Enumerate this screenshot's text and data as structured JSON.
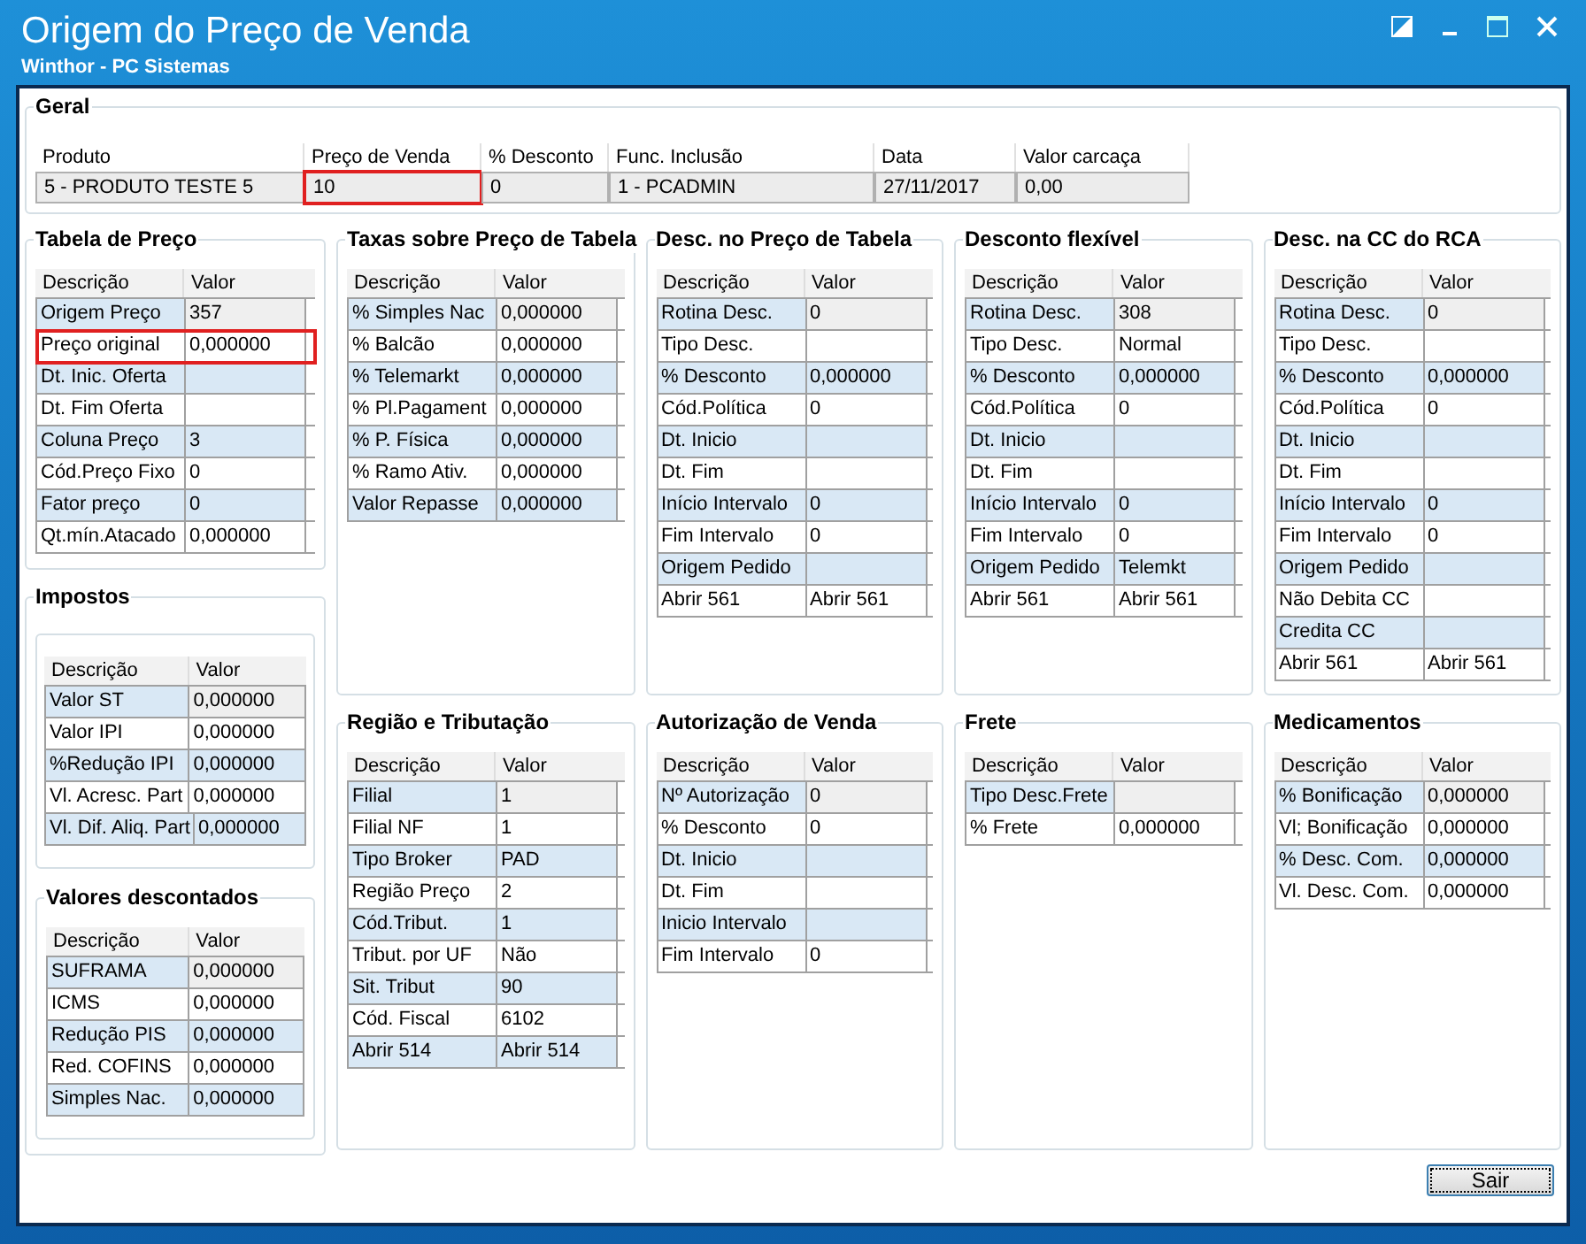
{
  "window": {
    "title": "Origem do Preço de Venda",
    "subtitle": "Winthor - PC Sistemas"
  },
  "geral": {
    "title": "Geral",
    "columns": [
      "Produto",
      "Preço de Venda",
      "% Desconto",
      "Func. Inclusão",
      "Data",
      "Valor carcaça"
    ],
    "row": [
      {
        "value": "5 - PRODUTO TESTE 5",
        "marked": false
      },
      {
        "value": "10",
        "marked": true
      },
      {
        "value": "0",
        "marked": false
      },
      {
        "value": "1 - PCADMIN",
        "marked": false
      },
      {
        "value": "27/11/2017",
        "marked": false
      },
      {
        "value": "0,00",
        "marked": false
      }
    ]
  },
  "columns": [
    [
      {
        "title": "Tabela de Preço",
        "kind": "plain",
        "headers": [
          "Descrição",
          "Valor"
        ],
        "rows": [
          {
            "label": "Origem Preço",
            "value": "357",
            "marked": false
          },
          {
            "label": "Preço original",
            "value": "0,000000",
            "marked": true
          },
          {
            "label": "Dt. Inic. Oferta",
            "value": "",
            "marked": false
          },
          {
            "label": "Dt. Fim Oferta",
            "value": "",
            "marked": false
          },
          {
            "label": "Coluna Preço",
            "value": "3",
            "marked": false
          },
          {
            "label": "Cód.Preço Fixo",
            "value": "0",
            "marked": false
          },
          {
            "label": "Fator preço",
            "value": "0",
            "marked": false
          },
          {
            "label": "Qt.mín.Atacado",
            "value": "0,000000",
            "marked": false
          }
        ]
      },
      {
        "title": "Impostos",
        "kind": "nested",
        "headers": [
          "Descrição",
          "Valor"
        ],
        "rows": [
          {
            "label": "Valor ST",
            "value": "0,000000",
            "marked": false
          },
          {
            "label": "Valor IPI",
            "value": "0,000000",
            "marked": false
          },
          {
            "label": "%Redução IPI",
            "value": "0,000000",
            "marked": false
          },
          {
            "label": "Vl. Acresc. Part",
            "value": "0,000000",
            "marked": false
          },
          {
            "label": "Vl. Dif. Aliq. Part",
            "value": "0,000000",
            "marked": false
          }
        ],
        "sub": {
          "title": "Valores descontados",
          "headers": [
            "Descrição",
            "Valor"
          ],
          "rows": [
            {
              "label": "SUFRAMA",
              "value": "0,000000",
              "marked": false
            },
            {
              "label": "ICMS",
              "value": "0,000000",
              "marked": false
            },
            {
              "label": "Redução PIS",
              "value": "0,000000",
              "marked": false
            },
            {
              "label": "Red. COFINS",
              "value": "0,000000",
              "marked": false
            },
            {
              "label": "Simples Nac.",
              "value": "0,000000",
              "marked": false
            }
          ]
        }
      }
    ],
    [
      {
        "title": "Taxas sobre Preço de Tabela",
        "kind": "plain",
        "headers": [
          "Descrição",
          "Valor"
        ],
        "rows": [
          {
            "label": "% Simples Nac",
            "value": "0,000000",
            "marked": false
          },
          {
            "label": "% Balcão",
            "value": "0,000000",
            "marked": false
          },
          {
            "label": "% Telemarkt",
            "value": "0,000000",
            "marked": false
          },
          {
            "label": "% Pl.Pagament",
            "value": "0,000000",
            "marked": false
          },
          {
            "label": "% P. Física",
            "value": "0,000000",
            "marked": false
          },
          {
            "label": "% Ramo Ativ.",
            "value": "0,000000",
            "marked": false
          },
          {
            "label": "Valor Repasse",
            "value": "0,000000",
            "marked": false
          }
        ]
      },
      {
        "title": "Região e Tributação",
        "kind": "plain",
        "headers": [
          "Descrição",
          "Valor"
        ],
        "rows": [
          {
            "label": "Filial",
            "value": "1",
            "marked": false
          },
          {
            "label": "Filial NF",
            "value": "1",
            "marked": false
          },
          {
            "label": "Tipo Broker",
            "value": "PAD",
            "marked": false
          },
          {
            "label": "Região Preço",
            "value": "2",
            "marked": false
          },
          {
            "label": "Cód.Tribut.",
            "value": "1",
            "marked": false
          },
          {
            "label": "Tribut. por UF",
            "value": "Não",
            "marked": false
          },
          {
            "label": "Sit. Tribut",
            "value": "90",
            "marked": false
          },
          {
            "label": "Cód. Fiscal",
            "value": "6102",
            "marked": false
          },
          {
            "label": "Abrir 514",
            "value": "Abrir 514",
            "marked": false
          }
        ]
      }
    ],
    [
      {
        "title": "Desc. no Preço de Tabela",
        "kind": "plain",
        "headers": [
          "Descrição",
          "Valor"
        ],
        "rows": [
          {
            "label": "Rotina Desc.",
            "value": "0",
            "marked": false
          },
          {
            "label": "Tipo Desc.",
            "value": "",
            "marked": false
          },
          {
            "label": "% Desconto",
            "value": "0,000000",
            "marked": false
          },
          {
            "label": "Cód.Política",
            "value": "0",
            "marked": false
          },
          {
            "label": "Dt. Inicio",
            "value": "",
            "marked": false
          },
          {
            "label": "Dt. Fim",
            "value": "",
            "marked": false
          },
          {
            "label": "Início Intervalo",
            "value": "0",
            "marked": false
          },
          {
            "label": "Fim Intervalo",
            "value": "0",
            "marked": false
          },
          {
            "label": "Origem  Pedido",
            "value": "",
            "marked": false
          },
          {
            "label": "Abrir 561",
            "value": "Abrir 561",
            "marked": false
          }
        ]
      },
      {
        "title": "Autorização de Venda",
        "kind": "plain",
        "headers": [
          "Descrição",
          "Valor"
        ],
        "rows": [
          {
            "label": "Nº Autorização",
            "value": "0",
            "marked": false
          },
          {
            "label": "% Desconto",
            "value": "0",
            "marked": false
          },
          {
            "label": "Dt. Inicio",
            "value": "",
            "marked": false
          },
          {
            "label": "Dt. Fim",
            "value": "",
            "marked": false
          },
          {
            "label": "Inicio Intervalo",
            "value": "",
            "marked": false
          },
          {
            "label": "Fim Intervalo",
            "value": "0",
            "marked": false
          }
        ]
      }
    ],
    [
      {
        "title": "Desconto flexível",
        "kind": "plain",
        "headers": [
          "Descrição",
          "Valor"
        ],
        "rows": [
          {
            "label": "Rotina Desc.",
            "value": "308",
            "marked": false
          },
          {
            "label": "Tipo Desc.",
            "value": "Normal",
            "marked": false
          },
          {
            "label": "% Desconto",
            "value": "0,000000",
            "marked": false
          },
          {
            "label": "Cód.Política",
            "value": "0",
            "marked": false
          },
          {
            "label": "Dt. Inicio",
            "value": "",
            "marked": false
          },
          {
            "label": "Dt. Fim",
            "value": "",
            "marked": false
          },
          {
            "label": "Início Intervalo",
            "value": "0",
            "marked": false
          },
          {
            "label": "Fim Intervalo",
            "value": "0",
            "marked": false
          },
          {
            "label": "Origem  Pedido",
            "value": "Telemkt",
            "marked": false
          },
          {
            "label": "Abrir 561",
            "value": "Abrir 561",
            "marked": false
          }
        ]
      },
      {
        "title": "Frete",
        "kind": "plain",
        "headers": [
          "Descrição",
          "Valor"
        ],
        "rows": [
          {
            "label": "Tipo Desc.Frete",
            "value": "",
            "marked": false
          },
          {
            "label": "% Frete",
            "value": "0,000000",
            "marked": false
          }
        ]
      }
    ],
    [
      {
        "title": "Desc. na CC do RCA",
        "kind": "plain",
        "headers": [
          "Descrição",
          "Valor"
        ],
        "rows": [
          {
            "label": "Rotina Desc.",
            "value": "0",
            "marked": false
          },
          {
            "label": "Tipo Desc.",
            "value": "",
            "marked": false
          },
          {
            "label": "% Desconto",
            "value": "0,000000",
            "marked": false
          },
          {
            "label": "Cód.Política",
            "value": "0",
            "marked": false
          },
          {
            "label": "Dt. Inicio",
            "value": "",
            "marked": false
          },
          {
            "label": "Dt. Fim",
            "value": "",
            "marked": false
          },
          {
            "label": "Início Intervalo",
            "value": "0",
            "marked": false
          },
          {
            "label": "Fim Intervalo",
            "value": "0",
            "marked": false
          },
          {
            "label": "Origem  Pedido",
            "value": "",
            "marked": false
          },
          {
            "label": "Não Debita CC",
            "value": "",
            "marked": false
          },
          {
            "label": "Credita CC",
            "value": "",
            "marked": false
          },
          {
            "label": "Abrir 561",
            "value": "Abrir 561",
            "marked": false
          }
        ]
      },
      {
        "title": "Medicamentos",
        "kind": "plain",
        "headers": [
          "Descrição",
          "Valor"
        ],
        "rows": [
          {
            "label": "% Bonificação",
            "value": "0,000000",
            "marked": false
          },
          {
            "label": "Vl; Bonificação",
            "value": "0,000000",
            "marked": false
          },
          {
            "label": "% Desc. Com.",
            "value": "0,000000",
            "marked": false
          },
          {
            "label": "Vl. Desc. Com.",
            "value": "0,000000",
            "marked": false
          }
        ]
      }
    ]
  ],
  "buttons": [
    "Sair"
  ]
}
